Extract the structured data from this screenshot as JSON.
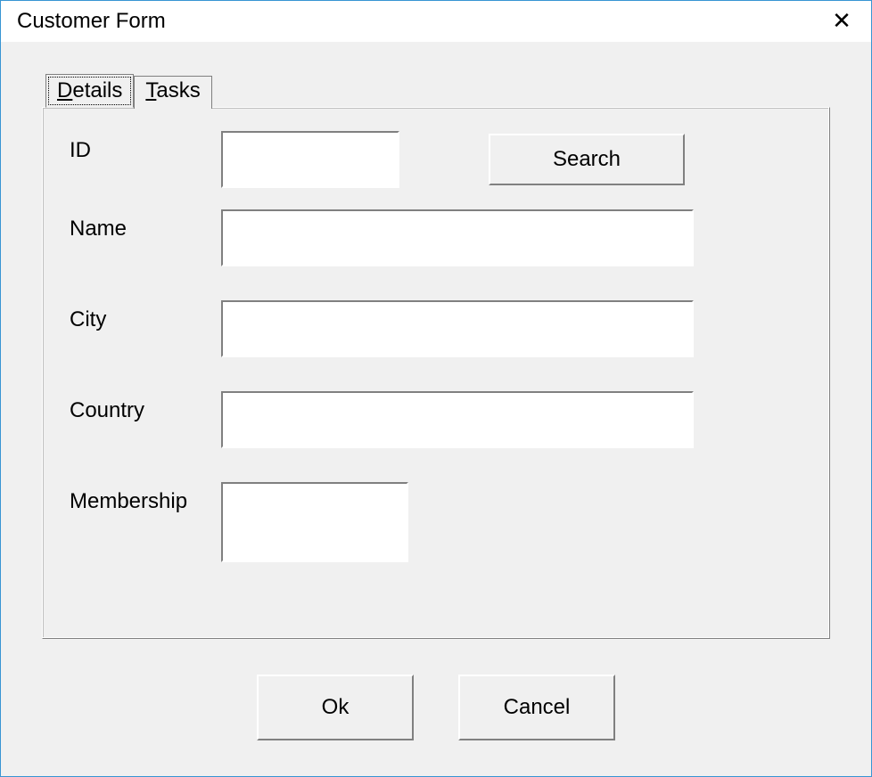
{
  "window": {
    "title": "Customer Form"
  },
  "tabs": {
    "details": {
      "label_mnemonic": "D",
      "label_rest": "etails"
    },
    "tasks": {
      "label_mnemonic": "T",
      "label_rest": "asks"
    }
  },
  "form": {
    "id": {
      "label": "ID",
      "value": ""
    },
    "search_button": "Search",
    "name": {
      "label": "Name",
      "value": ""
    },
    "city": {
      "label": "City",
      "value": ""
    },
    "country": {
      "label": "Country",
      "value": ""
    },
    "membership": {
      "label": "Membership",
      "value": ""
    }
  },
  "buttons": {
    "ok": "Ok",
    "cancel": "Cancel"
  }
}
